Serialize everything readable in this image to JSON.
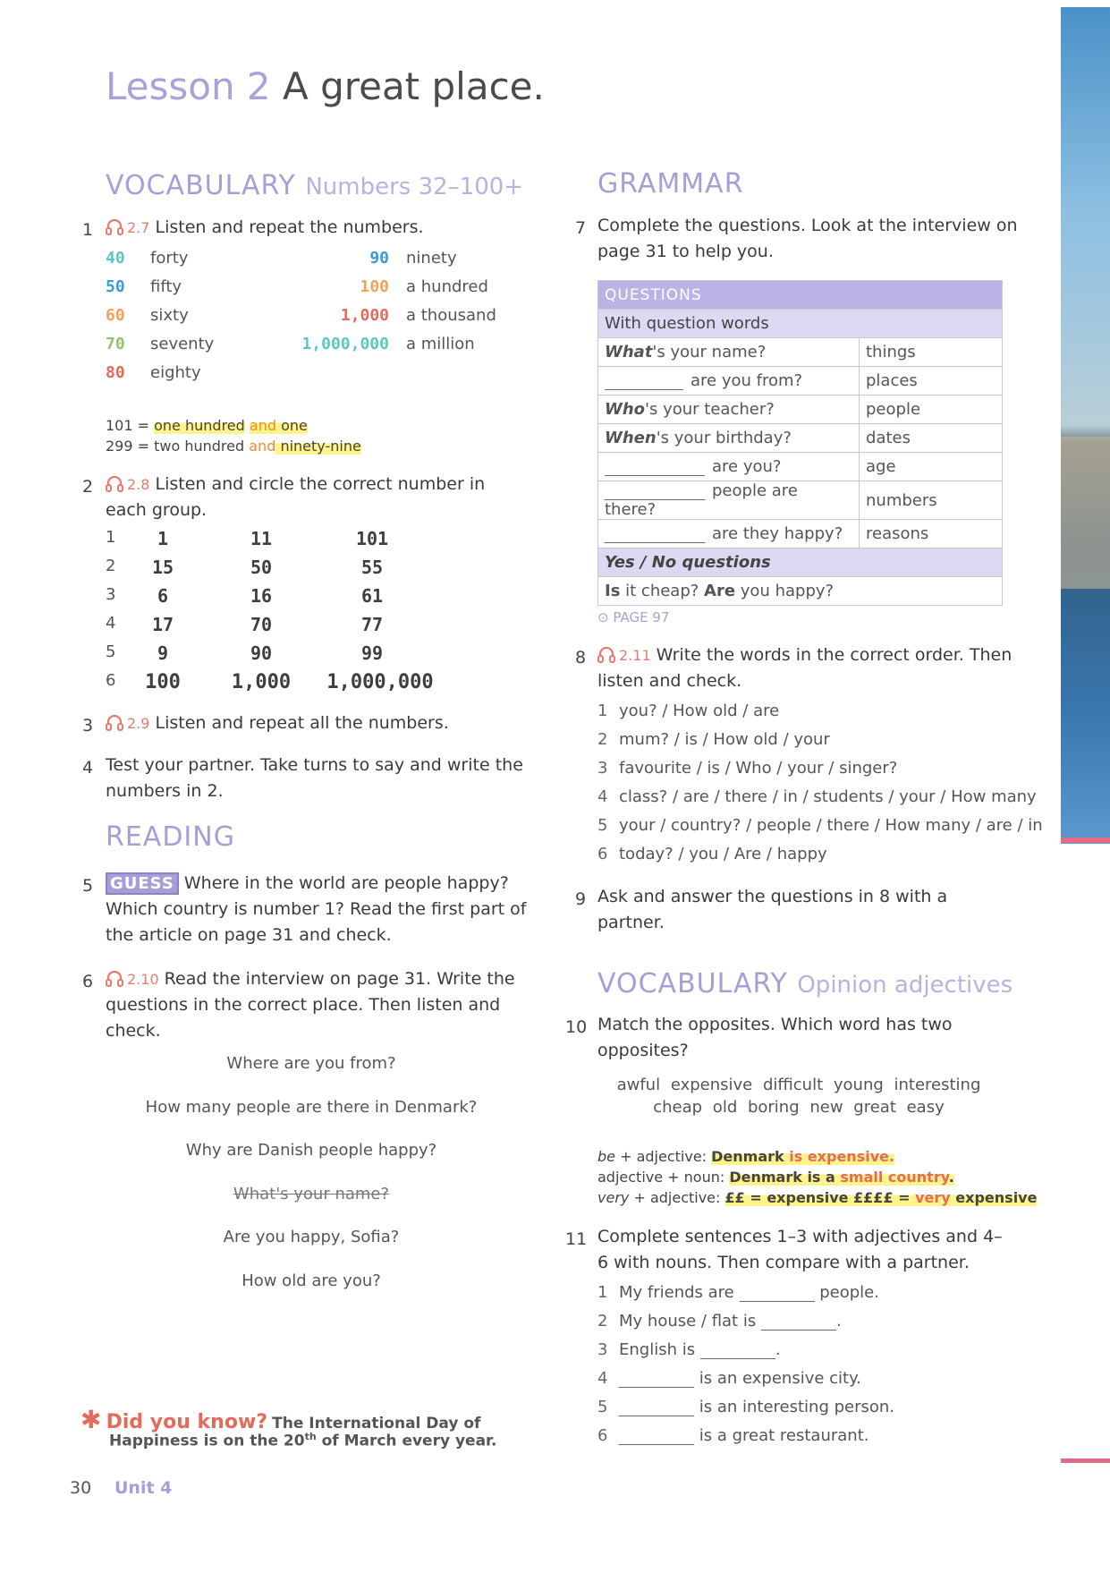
{
  "lesson": {
    "number": "Lesson 2",
    "title": "A great place."
  },
  "vocab1": {
    "heading": "VOCABULARY",
    "subheading": "Numbers 32–100+",
    "ex1": {
      "num": "1",
      "track": "2.7",
      "text": "Listen and repeat the numbers."
    },
    "numbers_left": [
      {
        "digit": "40",
        "word": "forty",
        "color": "#5ac7c0"
      },
      {
        "digit": "50",
        "word": "fifty",
        "color": "#3b9ad7"
      },
      {
        "digit": "60",
        "word": "sixty",
        "color": "#f2a25a"
      },
      {
        "digit": "70",
        "word": "seventy",
        "color": "#8fc46a"
      },
      {
        "digit": "80",
        "word": "eighty",
        "color": "#e46b5c"
      }
    ],
    "numbers_right": [
      {
        "digit": "90",
        "word": "ninety",
        "color": "#3b9ad7"
      },
      {
        "digit": "100",
        "word": "a hundred",
        "color": "#f2a25a"
      },
      {
        "digit": "1,000",
        "word": "a thousand",
        "color": "#e46b5c"
      },
      {
        "digit": "1,000,000",
        "word": "a million",
        "color": "#5ac7c0"
      }
    ],
    "ex101": {
      "pre": "101 = ",
      "a": "one hundred",
      "and": "and",
      "b": " one"
    },
    "ex299": {
      "pre": "299 = two hundred ",
      "and": "and",
      "b": " ninety-nine"
    }
  },
  "ex2": {
    "num": "2",
    "track": "2.8",
    "text": "Listen and circle the correct number in each group.",
    "rows": [
      {
        "n": "1",
        "a": "1",
        "b": "11",
        "c": "101"
      },
      {
        "n": "2",
        "a": "15",
        "b": "50",
        "c": "55"
      },
      {
        "n": "3",
        "a": "6",
        "b": "16",
        "c": "61"
      },
      {
        "n": "4",
        "a": "17",
        "b": "70",
        "c": "77"
      },
      {
        "n": "5",
        "a": "9",
        "b": "90",
        "c": "99"
      },
      {
        "n": "6",
        "a": "100",
        "b": "1,000",
        "c": "1,000,000"
      }
    ]
  },
  "ex3": {
    "num": "3",
    "track": "2.9",
    "text": "Listen and repeat all the numbers."
  },
  "ex4": {
    "num": "4",
    "text": "Test your partner. Take turns to say and write the numbers in 2."
  },
  "reading": {
    "heading": "READING"
  },
  "ex5": {
    "num": "5",
    "badge": "GUESS",
    "text": "Where in the world are people happy? Which country is number 1? Read the first part of the article on page 31 and check."
  },
  "ex6": {
    "num": "6",
    "track": "2.10",
    "text": "Read the interview on page 31. Write the questions in the correct place. Then listen and check.",
    "questions": [
      "Where are you from?",
      "How many people are there in Denmark?",
      "Why are Danish people happy?",
      "What's your name?",
      "Are you happy, Sofia?",
      "How old are you?"
    ]
  },
  "didyouknow": {
    "label": "Did you know?",
    "text1": "The International Day of",
    "text2a": "Happiness is on the 20",
    "sup": "th",
    "text2b": " of March every year."
  },
  "footer": {
    "page": "30",
    "unit": "Unit 4"
  },
  "grammar": {
    "heading": "GRAMMAR"
  },
  "ex7": {
    "num": "7",
    "text": "Complete the questions. Look at the interview on page 31 to help you.",
    "table": {
      "header": "QUESTIONS",
      "sub1": "With question words",
      "rows": [
        {
          "wh": "What",
          "rest": "'s your name?",
          "right": "things"
        },
        {
          "wh": "",
          "rest": "are you from?",
          "right": "places"
        },
        {
          "wh": "Who",
          "rest": "'s your teacher?",
          "right": "people"
        },
        {
          "wh": "When",
          "rest": "'s your birthday?",
          "right": "dates"
        },
        {
          "wh": "",
          "rest": "are you?",
          "right": "age"
        },
        {
          "wh": "",
          "rest": "people are there?",
          "right": "numbers"
        },
        {
          "wh": "",
          "rest": "are they happy?",
          "right": "reasons"
        }
      ],
      "sub2": "Yes / No questions",
      "yn_a": "Is",
      "yn_b": " it cheap? ",
      "yn_c": "Are",
      "yn_d": " you happy?"
    },
    "page_ref": "PAGE 97"
  },
  "ex8": {
    "num": "8",
    "track": "2.11",
    "text": "Write the words in the correct order. Then listen and check.",
    "items": [
      {
        "n": "1",
        "t": "you? / How old / are"
      },
      {
        "n": "2",
        "t": "mum? / is / How old / your"
      },
      {
        "n": "3",
        "t": "favourite / is / Who / your / singer?"
      },
      {
        "n": "4",
        "t": "class? / are / there / in / students / your / How many"
      },
      {
        "n": "5",
        "t": "your / country? / people / there / How many / are / in"
      },
      {
        "n": "6",
        "t": "today? / you / Are / happy"
      }
    ]
  },
  "ex9": {
    "num": "9",
    "text": "Ask and answer the questions in 8 with a partner."
  },
  "vocab2": {
    "heading": "VOCABULARY",
    "subheading": "Opinion adjectives"
  },
  "ex10": {
    "num": "10",
    "text": "Match the opposites. Which word has two opposites?",
    "line1": "awful expensive difficult young interesting",
    "line2": "cheap old boring new great easy"
  },
  "rules": {
    "r1a": "be",
    "r1b": " + adjective: ",
    "r1c": "Denmark",
    "r1d": " is expensive.",
    "r2a": "adjective + noun: ",
    "r2b": "Denmark is a ",
    "r2c": "small country",
    "r2d": ".",
    "r3a": "very",
    "r3b": " + adjective: ",
    "r3c": "££ = expensive  ££££ = ",
    "r3d": "very",
    "r3e": " expensive"
  },
  "ex11": {
    "num": "11",
    "text": "Complete sentences 1–3 with adjectives and 4–6 with nouns. Then compare with a partner.",
    "items": [
      {
        "n": "1",
        "pre": "My friends are",
        "post": "people."
      },
      {
        "n": "2",
        "pre": "My house / flat is",
        "post": "."
      },
      {
        "n": "3",
        "pre": "English is",
        "post": "."
      },
      {
        "n": "4",
        "pre": "",
        "post": "is an expensive city."
      },
      {
        "n": "5",
        "pre": "",
        "post": "is an interesting person."
      },
      {
        "n": "6",
        "pre": "",
        "post": "is a great restaurant."
      }
    ]
  }
}
